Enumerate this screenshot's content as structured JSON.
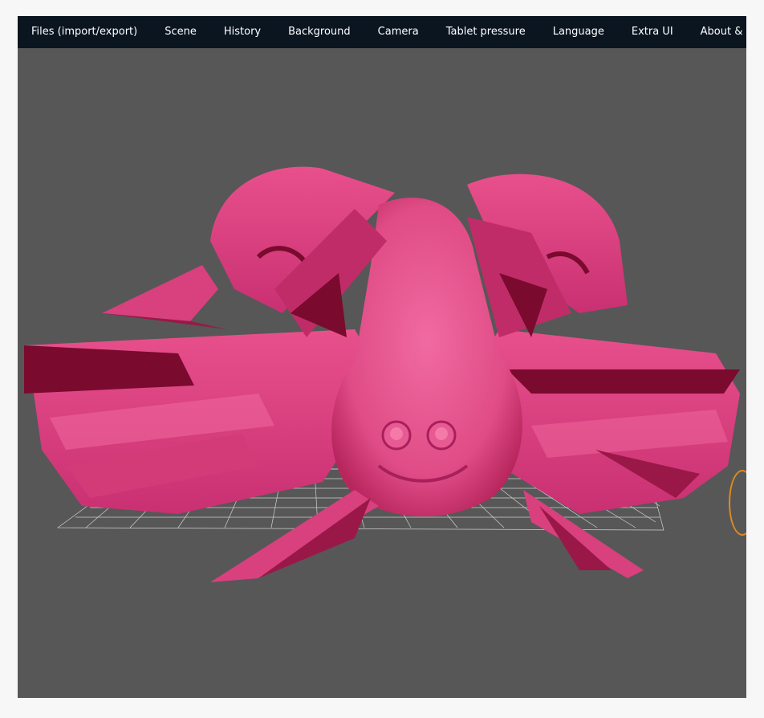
{
  "menu": {
    "items": [
      {
        "label": "Files (import/export)"
      },
      {
        "label": "Scene"
      },
      {
        "label": "History"
      },
      {
        "label": "Background"
      },
      {
        "label": "Camera"
      },
      {
        "label": "Tablet pressure"
      },
      {
        "label": "Language"
      },
      {
        "label": "Extra UI"
      },
      {
        "label": "About &"
      }
    ]
  },
  "colors": {
    "menubar_bg": "#0a1520",
    "viewport_bg": "#575757",
    "mesh_main": "#e8508c",
    "mesh_shadow": "#7a0a2e",
    "grid": "#d0d0d0",
    "pivot_ring": "#e08a1e"
  }
}
